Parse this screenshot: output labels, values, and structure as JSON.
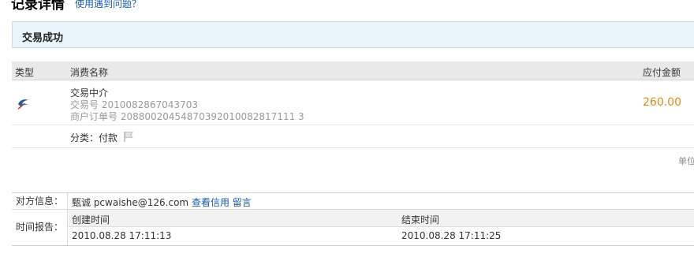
{
  "header": {
    "title": "记录详情",
    "help_link": "使用遇到问题？"
  },
  "status": {
    "text": "交易成功",
    "box_color": "#eaf4fb"
  },
  "table": {
    "columns": {
      "type": "类型",
      "name": "消费名称",
      "amount": "应付金额"
    },
    "row": {
      "icon": "swallow-logo-icon",
      "name": "交易中介",
      "trade_no": "交易号 2010082867043703",
      "order_no": "商户订单号 20880020454870392010082817111 3",
      "amount": "260.00",
      "amount_color": "#e08a1a"
    },
    "category": "分类：付款",
    "unit": "单位"
  },
  "info": {
    "counterparty_label": "对方信息：",
    "counterparty_name": "甄诚 pcwaishe@126.com",
    "view_credit": "查看信用",
    "message": "留言",
    "time_label": "时间报告：",
    "created_header": "创建时间",
    "ended_header": "结束时间",
    "created_value": "2010.08.28 17:11:13",
    "ended_value": "2010.08.28 17:11:25"
  }
}
